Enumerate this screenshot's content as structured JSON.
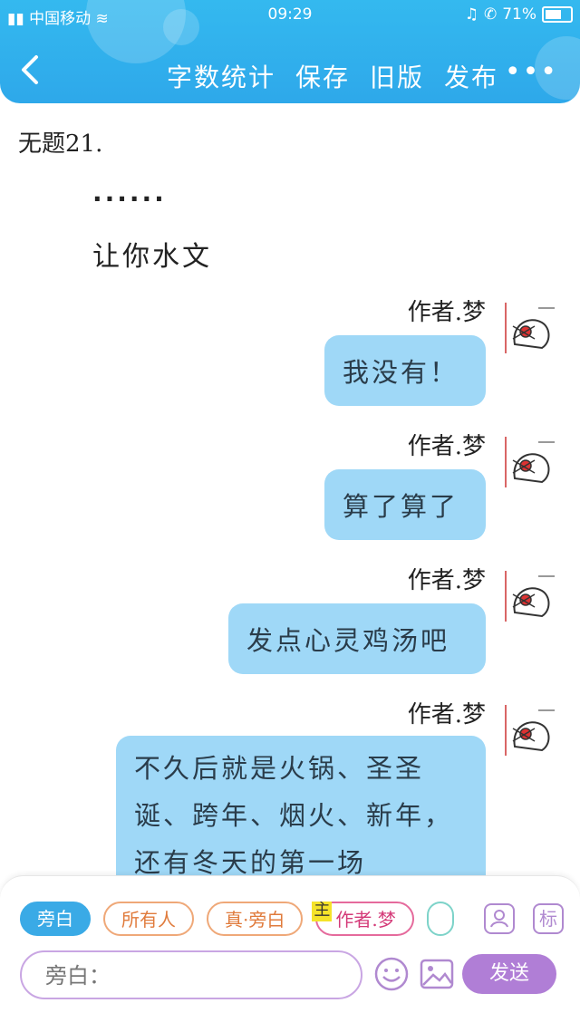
{
  "status_bar": {
    "carrier": "中国移动",
    "time": "09:29",
    "battery": "71%",
    "battery_level": 0.71
  },
  "toolbar": {
    "back_icon": "chevron-left-icon",
    "actions": [
      "字数统计",
      "保存",
      "旧版",
      "发布"
    ],
    "more": "•••"
  },
  "doc": {
    "title": "无题21.",
    "dots": "......",
    "narration": "让你水文"
  },
  "messages": [
    {
      "author": "作者.梦",
      "text": "我没有！"
    },
    {
      "author": "作者.梦",
      "text": "算了算了"
    },
    {
      "author": "作者.梦",
      "text": "发点心灵鸡汤吧"
    },
    {
      "author": "作者.梦",
      "text": "不久后就是火锅、圣圣诞、跨年、烟火、新年，还有冬天的第一场"
    }
  ],
  "composer": {
    "roles": [
      "旁白",
      "所有人",
      "真·旁白",
      "作者.梦"
    ],
    "active_role": "旁白",
    "main_tag": "主",
    "contact_icon": "user-card-icon",
    "tag_button": "标",
    "input_placeholder": "旁白：",
    "emoji_icon": "smile-icon",
    "image_icon": "image-icon",
    "send_label": "发送"
  },
  "colors": {
    "header": "#34b9ef",
    "bubble": "#9fd8f7",
    "accent_purple": "#b07ed6"
  }
}
